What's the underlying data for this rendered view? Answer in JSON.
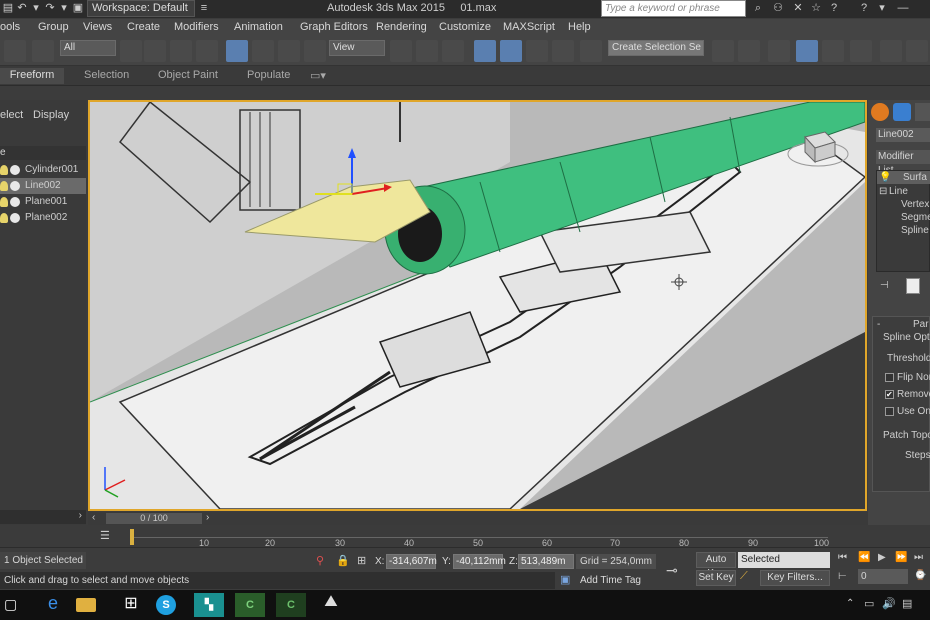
{
  "titlebar": {
    "workspace": "Workspace: Default",
    "app_title": "Autodesk 3ds Max  2015",
    "file_name": "01.max",
    "search_placeholder": "Type a keyword or phrase"
  },
  "menubar": {
    "items": [
      "ools",
      "Group",
      "Views",
      "Create",
      "Modifiers",
      "Animation",
      "Graph Editors",
      "Rendering",
      "Customize",
      "MAXScript",
      "Help"
    ]
  },
  "toolbar": {
    "filter_value": "All",
    "ref_coord_value": "View",
    "selection_set_value": "Create Selection Se"
  },
  "ribbon": {
    "tabs": [
      "Freeform",
      "Selection",
      "Object Paint",
      "Populate"
    ]
  },
  "explorer": {
    "tabs": [
      "elect",
      "Display"
    ],
    "header": "e",
    "items": [
      {
        "label": "Cylinder001"
      },
      {
        "label": "Line002"
      },
      {
        "label": "Plane001"
      },
      {
        "label": "Plane002"
      }
    ]
  },
  "command_panel": {
    "object_name": "Line002",
    "modifier_list": "Modifier List",
    "stack": [
      "Surfa",
      "Line",
      "Vertex",
      "Segmen",
      "Spline"
    ],
    "rollout_title": "Par",
    "spline_options": "Spline Optio",
    "threshold": "Threshold:",
    "flip_normals": "Flip Nor",
    "remove": "Remove",
    "use_only": "Use Onl",
    "patch_topology": "Patch Topo",
    "steps": "Steps"
  },
  "timeline": {
    "frame_display": "0 / 100",
    "ticks": [
      "10",
      "20",
      "30",
      "40",
      "50",
      "60",
      "70",
      "80",
      "90",
      "100"
    ]
  },
  "status": {
    "selected": "1 Object Selected",
    "prompt": "Click and drag to select and move objects",
    "x_label": "X:",
    "x_value": "-314,607m",
    "y_label": "Y:",
    "y_value": "-40,112mm",
    "z_label": "Z:",
    "z_value": "513,489m",
    "grid": "Grid = 254,0mm",
    "add_time_tag": "Add Time Tag",
    "auto_key": "Auto Key",
    "selected_dropdown": "Selected",
    "set_key": "Set Key",
    "key_filters": "Key Filters...",
    "frame_value": "0"
  },
  "colors": {
    "accent_selected": "#5a7fb0",
    "viewport_border": "#e0a62a",
    "pen_body": "#3fbf7f",
    "nib": "#efe79c"
  }
}
